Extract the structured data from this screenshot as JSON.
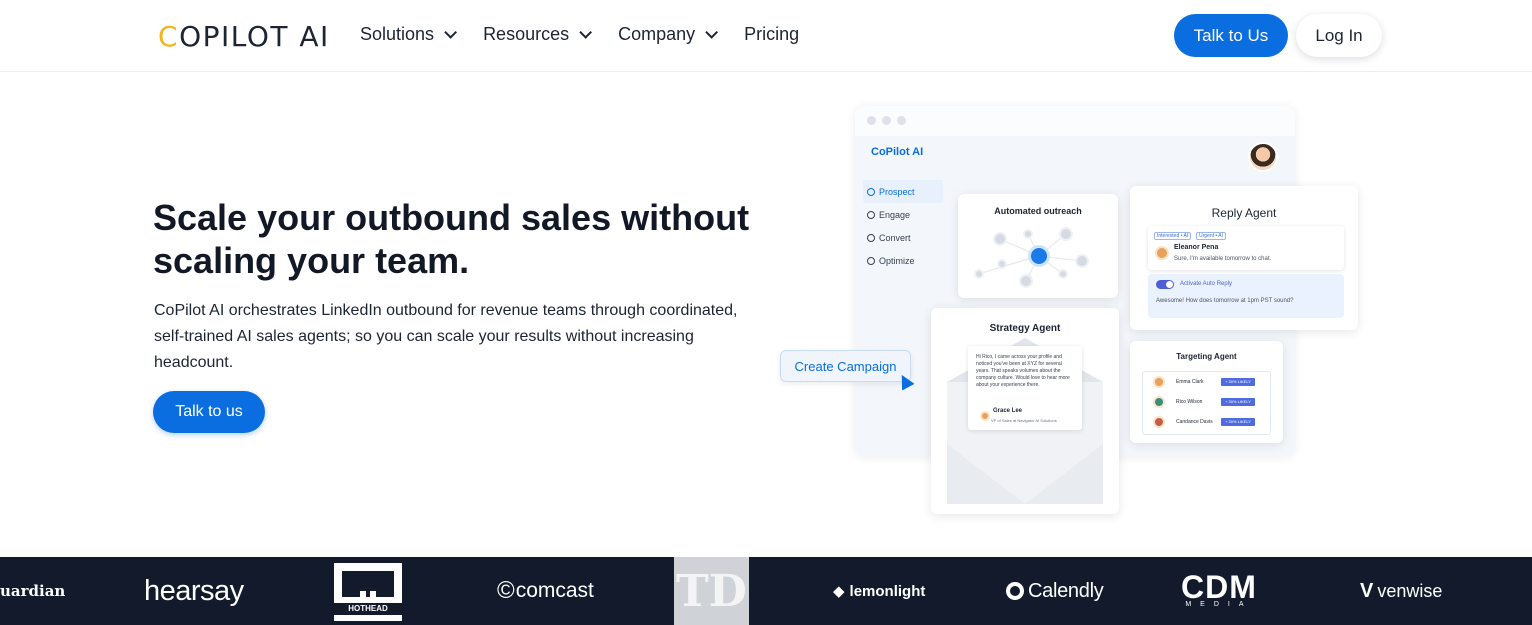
{
  "nav": {
    "logo_first": "C",
    "logo_rest": "OPILOT AI",
    "items": [
      {
        "label": "Solutions",
        "has_dropdown": true
      },
      {
        "label": "Resources",
        "has_dropdown": true
      },
      {
        "label": "Company",
        "has_dropdown": true
      },
      {
        "label": "Pricing",
        "has_dropdown": false
      }
    ],
    "talk_button": "Talk to Us",
    "login_button": "Log In"
  },
  "hero": {
    "title": "Scale your outbound sales without scaling your team.",
    "subtitle": "CoPilot AI orchestrates LinkedIn outbound for revenue teams through coordinated, self-trained AI sales agents; so you can scale your results without increasing headcount.",
    "cta": "Talk to us"
  },
  "mockup": {
    "brand": "CoPilot AI",
    "sidebar": [
      "Prospect",
      "Engage",
      "Convert",
      "Optimize"
    ],
    "outreach_title": "Automated outreach",
    "reply": {
      "title": "Reply Agent",
      "tags": [
        "Interested • AI",
        "Urgent • AI"
      ],
      "name": "Eleanor Pena",
      "message": "Sure, I'm available tomorrow to chat.",
      "toggle_label": "Activate Auto Reply",
      "auto_reply": "Awesome! How does tomorrow at 1pm PST sound?"
    },
    "strategy": {
      "title": "Strategy Agent",
      "letter": "Hi Rico, I came across your profile and noticed you've been at XYZ for several years. That speaks volumes about the company culture. Would love to hear more about your experience there.",
      "sender": "Grace Lee",
      "sender_title": "VP of Sales at Navigator AI Solutions"
    },
    "targeting": {
      "title": "Targeting Agent",
      "rows": [
        {
          "name": "Emma Clark",
          "badge": "+ 30% LIKELY"
        },
        {
          "name": "Rico Wilson",
          "badge": "+ 30% LIKELY"
        },
        {
          "name": "Candance Davis",
          "badge": "+ 30% LIKELY"
        }
      ]
    },
    "campaign_button": "Create Campaign"
  },
  "logos": {
    "guardian": "uardian",
    "hearsay": "hearsay",
    "hothead": "HOTHEAD",
    "comcast": "comcast",
    "td": "TD",
    "lemonlight": "lemonlight",
    "calendly": "Calendly",
    "cdm": "CDM",
    "cdm_sub": "MEDIA",
    "venwise": "venwise"
  },
  "colors": {
    "primary": "#0a6ee0",
    "logo_accent": "#f4b41a",
    "strip_bg": "#121a2b"
  }
}
